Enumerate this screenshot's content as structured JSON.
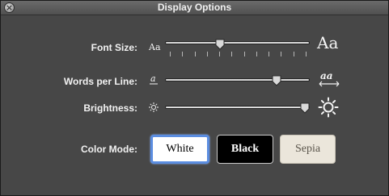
{
  "window": {
    "title": "Display Options"
  },
  "font_size": {
    "label": "Font Size:",
    "min_glyph": "Aa",
    "max_glyph": "Aa",
    "level": 0.37
  },
  "words_per_line": {
    "label": "Words per Line:",
    "level": 0.79
  },
  "brightness": {
    "label": "Brightness:",
    "level": 1.0
  },
  "color_mode": {
    "label": "Color Mode:",
    "options": [
      "White",
      "Black",
      "Sepia"
    ],
    "selected": "White"
  },
  "colors": {
    "background": "#474747",
    "focus_ring": "#5b8de0",
    "sepia": "#ebe6db"
  },
  "icons": [
    "close-icon",
    "small-font-icon",
    "large-font-icon",
    "narrow-words-icon",
    "wide-words-icon",
    "dim-sun-icon",
    "bright-sun-icon"
  ]
}
